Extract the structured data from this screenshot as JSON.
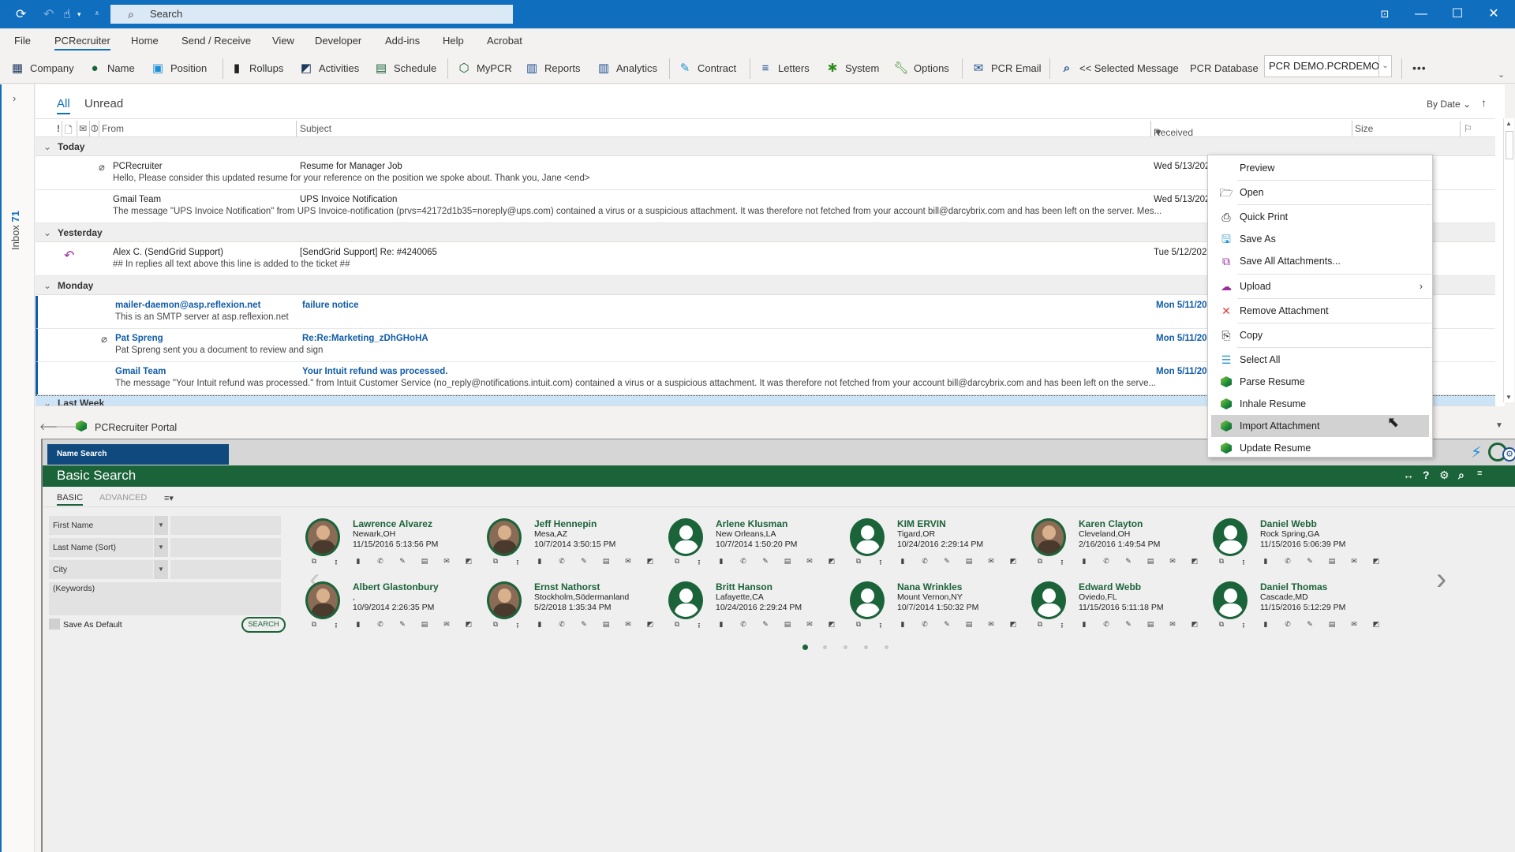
{
  "titlebar": {
    "search_placeholder": "Search",
    "qa_icons": [
      "sync-icon",
      "undo-icon",
      "touch-mode-icon",
      "customize-qa-icon"
    ],
    "window_buttons": [
      "ribbon-display-options",
      "minimize",
      "maximize",
      "close"
    ]
  },
  "menubar": {
    "items": [
      "File",
      "PCRecruiter",
      "Home",
      "Send / Receive",
      "View",
      "Developer",
      "Add-ins",
      "Help",
      "Acrobat"
    ],
    "active": "PCRecruiter"
  },
  "ribbon": {
    "buttons": [
      {
        "label": "Company",
        "icon": "company-icon"
      },
      {
        "label": "Name",
        "icon": "person-icon"
      },
      {
        "label": "Position",
        "icon": "briefcase-icon"
      },
      {
        "label": "Rollups",
        "icon": "binder-icon"
      },
      {
        "label": "Activities",
        "icon": "activities-icon"
      },
      {
        "label": "Schedule",
        "icon": "calendar-icon"
      },
      {
        "label": "MyPCR",
        "icon": "mypcr-icon"
      },
      {
        "label": "Reports",
        "icon": "report-chart-icon"
      },
      {
        "label": "Analytics",
        "icon": "analytics-chart-icon"
      },
      {
        "label": "Contract",
        "icon": "contract-icon"
      },
      {
        "label": "Letters",
        "icon": "letters-icon"
      },
      {
        "label": "System",
        "icon": "gear-icon"
      },
      {
        "label": "Options",
        "icon": "wrench-icon"
      },
      {
        "label": "PCR Email",
        "icon": "envelope-icon"
      },
      {
        "label": "<< Selected Message",
        "icon": "search-icon"
      }
    ],
    "db_label": "PCR Database",
    "db_value": "PCR DEMO.PCRDEMO",
    "more": "•••"
  },
  "folderpane": {
    "folder": "Inbox",
    "count": "71"
  },
  "maillist": {
    "tabs": [
      "All",
      "Unread"
    ],
    "active_tab": "All",
    "sort_label": "By Date",
    "columns": [
      "From",
      "Subject",
      "Received",
      "Size"
    ],
    "groups": [
      {
        "label": "Today",
        "messages": [
          {
            "from": "PCRecruiter",
            "subject": "Resume for Manager Job",
            "preview": "Hello,  Please consider this updated resume for your reference on the position we spoke about.  Thank you,  Jane <end>",
            "received": "Wed 5/13/202",
            "attachment": true,
            "unread": false,
            "replied": false
          },
          {
            "from": "Gmail Team",
            "subject": "UPS Invoice Notification",
            "preview": "The message \"UPS Invoice Notification\" from UPS Invoice-notification (prvs=42172d1b35=noreply@ups.com) contained a virus or a suspicious attachment. It was therefore not fetched from your account bill@darcybrix.com and has been left on the server.   Mes...",
            "received": "Wed 5/13/202",
            "attachment": false,
            "unread": false,
            "replied": false
          }
        ]
      },
      {
        "label": "Yesterday",
        "messages": [
          {
            "from": "Alex C. (SendGrid Support)",
            "subject": "[SendGrid Support] Re: #4240065",
            "preview": "## In replies all text above this line is added to the ticket ##",
            "received": "Tue 5/12/202",
            "attachment": false,
            "unread": false,
            "replied": true
          }
        ]
      },
      {
        "label": "Monday",
        "messages": [
          {
            "from": "mailer-daemon@asp.reflexion.net",
            "subject": "failure notice",
            "preview": "This is an SMTP server at asp.reflexion.net",
            "received": "Mon 5/11/20",
            "attachment": false,
            "unread": true,
            "replied": false
          },
          {
            "from": "Pat Spreng",
            "subject": "Re:Re:Marketing_zDhGHoHA",
            "preview": "Pat Spreng sent you a document to review and sign",
            "received": "Mon 5/11/20",
            "attachment": true,
            "unread": true,
            "replied": false
          },
          {
            "from": "Gmail Team",
            "subject": "Your Intuit refund was processed.",
            "preview": "The message \"Your Intuit refund was processed.\" from Intuit Customer Service (no_reply@notifications.intuit.com) contained a virus or a suspicious attachment. It was therefore not fetched from your account bill@darcybrix.com and has been left on the serve...",
            "received": "Mon 5/11/20",
            "attachment": false,
            "unread": true,
            "replied": false
          }
        ]
      },
      {
        "label": "Last Week",
        "messages": []
      }
    ]
  },
  "context_menu": {
    "items": [
      {
        "label": "Preview",
        "icon": ""
      },
      {
        "label": "Open",
        "icon": "folder-open-icon"
      },
      {
        "label": "Quick Print",
        "icon": "printer-icon"
      },
      {
        "label": "Save As",
        "icon": "save-as-icon"
      },
      {
        "label": "Save All Attachments...",
        "icon": "save-all-icon"
      },
      {
        "label": "Upload",
        "icon": "cloud-upload-icon",
        "submenu": true
      },
      {
        "label": "Remove Attachment",
        "icon": "remove-x-icon"
      },
      {
        "label": "Copy",
        "icon": "copy-icon"
      },
      {
        "label": "Select All",
        "icon": "select-all-icon"
      },
      {
        "label": "Parse Resume",
        "icon": "pcr-icon"
      },
      {
        "label": "Inhale Resume",
        "icon": "pcr-icon"
      },
      {
        "label": "Import Attachment",
        "icon": "pcr-icon",
        "highlighted": true
      },
      {
        "label": "Update Resume",
        "icon": "pcr-icon"
      }
    ]
  },
  "portal": {
    "title": "PCRecruiter Portal",
    "name_search_tab": "Name Search",
    "header": "Basic Search",
    "subtabs": [
      "BASIC",
      "ADVANCED"
    ],
    "active_subtab": "BASIC",
    "fields": [
      {
        "label": "First Name",
        "value": ""
      },
      {
        "label": "Last Name (Sort)",
        "value": ""
      },
      {
        "label": "City",
        "value": ""
      }
    ],
    "keywords_placeholder": "(Keywords)",
    "save_default_label": "Save As Default",
    "search_button": "SEARCH",
    "colors": {
      "green": "#1b6339",
      "blue": "#10497e"
    },
    "candidates": [
      {
        "name": "Lawrence Alvarez",
        "location": "Newark,OH",
        "timestamp": "11/15/2016 5:13:56 PM",
        "photo": true
      },
      {
        "name": "Jeff Hennepin",
        "location": "Mesa,AZ",
        "timestamp": "10/7/2014 3:50:15 PM",
        "photo": true
      },
      {
        "name": "Arlene Klusman",
        "location": "New Orleans,LA",
        "timestamp": "10/7/2014 1:50:20 PM",
        "photo": false
      },
      {
        "name": "KIM ERVIN",
        "location": "Tigard,OR",
        "timestamp": "10/24/2016 2:29:14 PM",
        "photo": false
      },
      {
        "name": "Karen Clayton",
        "location": "Cleveland,OH",
        "timestamp": "2/16/2016 1:49:54 PM",
        "photo": true
      },
      {
        "name": "Daniel Webb",
        "location": "Rock Spring,GA",
        "timestamp": "11/15/2016 5:06:39 PM",
        "photo": false
      },
      {
        "name": "Albert Glastonbury",
        "location": ",",
        "timestamp": "10/9/2014 2:26:35 PM",
        "photo": true
      },
      {
        "name": "Ernst Nathorst",
        "location": "Stockholm,Södermanland",
        "timestamp": "5/2/2018 1:35:34 PM",
        "photo": true
      },
      {
        "name": "Britt Hanson",
        "location": "Lafayette,CA",
        "timestamp": "10/24/2016 2:29:24 PM",
        "photo": false
      },
      {
        "name": "Nana Wrinkles",
        "location": "Mount Vernon,NY",
        "timestamp": "10/7/2014 1:50:32 PM",
        "photo": false
      },
      {
        "name": "Edward Webb",
        "location": "Oviedo,FL",
        "timestamp": "11/15/2016 5:11:18 PM",
        "photo": false
      },
      {
        "name": "Daniel Thomas",
        "location": "Cascade,MD",
        "timestamp": "11/15/2016 5:12:29 PM",
        "photo": false
      }
    ],
    "card_actions": [
      "open-icon",
      "upload-icon",
      "binder-icon",
      "phone-icon",
      "edit-note-icon",
      "document-icon",
      "email-icon",
      "chat-icon"
    ],
    "pagination": {
      "current": 1,
      "total": 5
    }
  }
}
